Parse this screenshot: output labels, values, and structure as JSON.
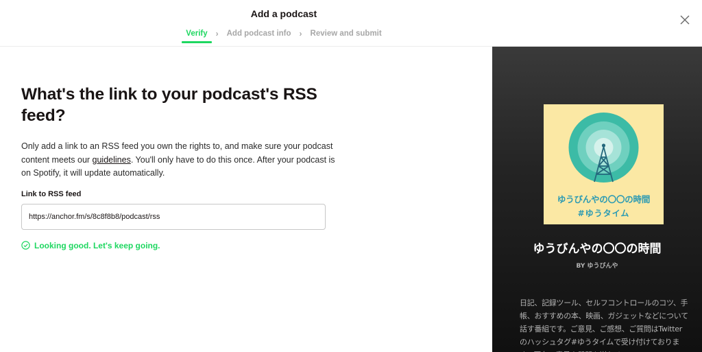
{
  "header": {
    "title": "Add a podcast",
    "steps": [
      {
        "label": "Verify",
        "active": true
      },
      {
        "label": "Add podcast info",
        "active": false
      },
      {
        "label": "Review and submit",
        "active": false
      }
    ],
    "step_separator": "›",
    "close_icon": "close-icon"
  },
  "main": {
    "heading": "What's the link to your podcast's RSS feed?",
    "description_part1": "Only add a link to an RSS feed you own the rights to, and make sure your podcast content meets our ",
    "description_link": "guidelines",
    "description_part2": ". You'll only have to do this once. After your podcast is on Spotify, it will update automatically.",
    "field_label": "Link to RSS feed",
    "rss_value": "https://anchor.fm/s/8c8f8b8/podcast/rss",
    "status_text": "Looking good. Let's keep going.",
    "status_icon": "check-circle-icon"
  },
  "preview": {
    "cover_title": "ゆうびんやの〇〇の時間",
    "cover_tag": "#ゆうタイム",
    "cover_icon": "radio-tower-icon",
    "podcast_name": "ゆうびんやの〇〇の時間",
    "by_line": "BY ゆうびんや",
    "description": "日記、記録ツール、セルフコントロールのコツ、手帳、おすすめの本、映画、ガジェットなどについて話す番組です。ご意見、ご感想、ご質問はTwitterのハッシュタグ#ゆうタイムで受け付けております。匿名で意見や質問を送れる"
  },
  "colors": {
    "accent": "#1ed760",
    "cover_bg": "#fbe8a4",
    "cover_text": "#2b9ab3",
    "panel_bg": "#242424"
  }
}
